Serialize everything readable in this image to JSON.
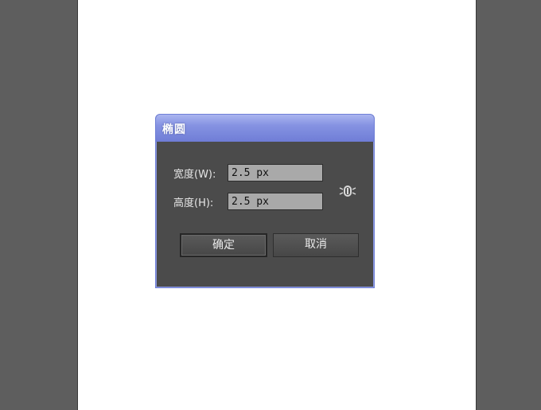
{
  "dialog": {
    "title": "椭圆",
    "width_field": {
      "label": "宽度(W):",
      "value": "2.5 px"
    },
    "height_field": {
      "label": "高度(H):",
      "value": "2.5 px"
    },
    "constrain_icon": "link-icon",
    "ok_label": "确定",
    "cancel_label": "取消"
  },
  "colors": {
    "pasteboard": "#5e5e5e",
    "artboard": "#ffffff",
    "dialog_body": "#4b4b4b",
    "titlebar_accent": "#8592e2",
    "input_bg": "#a9a9a9"
  }
}
